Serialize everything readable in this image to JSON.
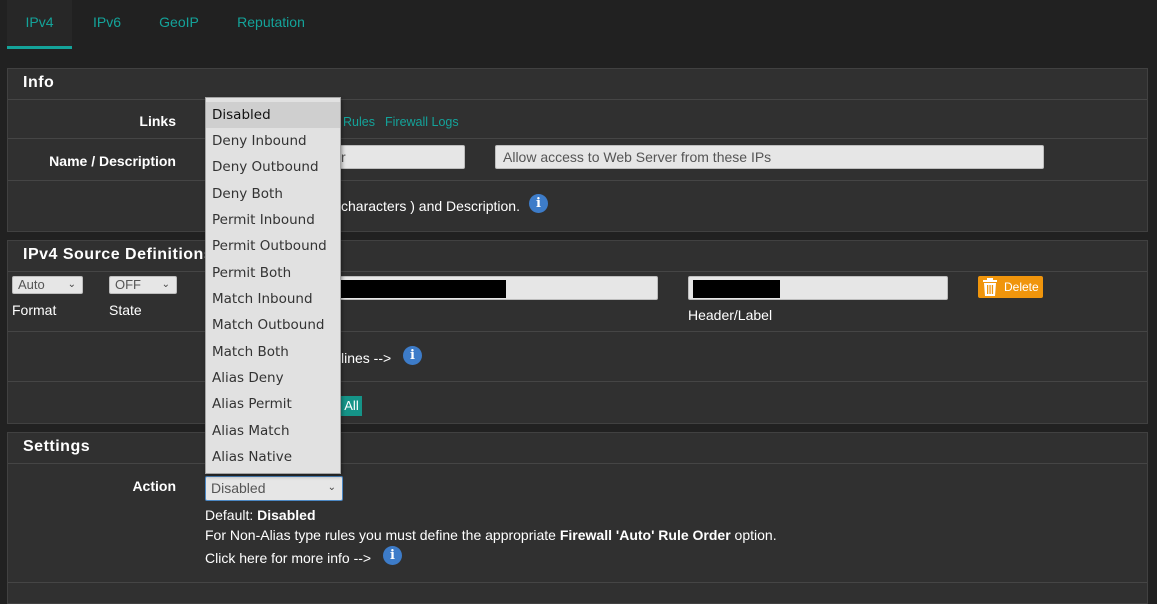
{
  "tabs": [
    {
      "label": "IPv4",
      "active": true
    },
    {
      "label": "IPv6",
      "active": false
    },
    {
      "label": "GeoIP",
      "active": false
    },
    {
      "label": "Reputation",
      "active": false
    }
  ],
  "info": {
    "title": "Info",
    "links_label": "Links",
    "link_rules": "Rules",
    "link_firewall_logs": "Firewall Logs",
    "name_desc_label": "Name / Description",
    "name_value_partial": "r",
    "description_value": "Allow access to Web Server from these IPs",
    "hint_text": "characters ) and Description."
  },
  "source": {
    "title": "IPv4 Source Definitions",
    "format_value": "Auto",
    "format_label": "Format",
    "state_value": "OFF",
    "state_label": "State",
    "header_label": "Header/Label",
    "delete_label": "Delete",
    "lines_text": "lines -->",
    "all_button": "All"
  },
  "settings": {
    "title": "Settings",
    "action_label": "Action",
    "action_value": "Disabled",
    "default_prefix": "Default: ",
    "default_value": "Disabled",
    "nonalias_prefix": "For Non-Alias type rules you must define the appropriate ",
    "nonalias_bold": "Firewall 'Auto' Rule Order",
    "nonalias_suffix": " option.",
    "more_info": "Click here for more info -->"
  },
  "action_options": [
    "Disabled",
    "Deny Inbound",
    "Deny Outbound",
    "Deny Both",
    "Permit Inbound",
    "Permit Outbound",
    "Permit Both",
    "Match Inbound",
    "Match Outbound",
    "Match Both",
    "Alias Deny",
    "Alias Permit",
    "Alias Match",
    "Alias Native"
  ],
  "icons": {
    "info": "info-circle-icon",
    "delete": "trash-icon",
    "chevron": "chevron-down-icon"
  },
  "colors": {
    "accent": "#14a39a",
    "info_blue": "#3d7cc9",
    "delete_orange": "#f0950c"
  }
}
